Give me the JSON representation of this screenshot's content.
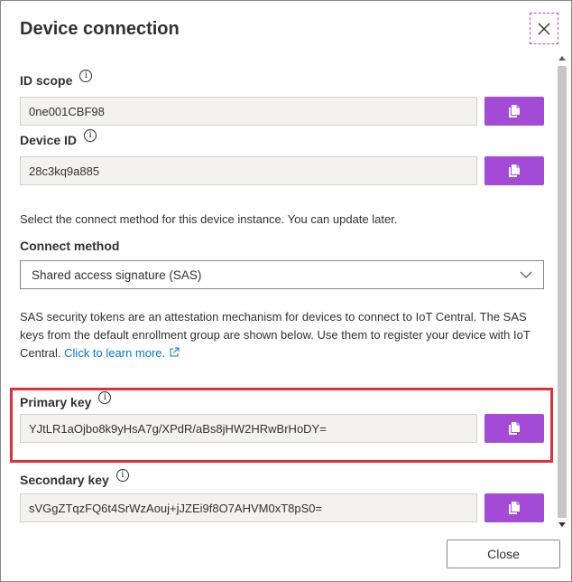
{
  "dialog": {
    "title": "Device connection",
    "close_icon": "close-icon"
  },
  "id_scope": {
    "label": "ID scope",
    "value": "0ne001CBF98"
  },
  "device_id": {
    "label": "Device ID",
    "value": "28c3kq9a885"
  },
  "connect": {
    "instructions": "Select the connect method for this device instance. You can update later.",
    "method_label": "Connect method",
    "method_value": "Shared access signature (SAS)"
  },
  "sas_info": {
    "text": "SAS security tokens are an attestation mechanism for devices to connect to IoT Central. The SAS keys from the default enrollment group are shown below. Use them to register your device with IoT Central.",
    "link": "Click to learn more."
  },
  "primary_key": {
    "label": "Primary key",
    "value": "YJtLR1aOjbo8k9yHsA7g/XPdR/aBs8jHW2HRwBrHoDY="
  },
  "secondary_key": {
    "label": "Secondary key",
    "value": "sVGgZTqzFQ6t4SrWzAouj+jJZEi9f8O7AHVM0xT8pS0="
  },
  "footer": {
    "close_label": "Close"
  },
  "colors": {
    "accent": "#a34ad6",
    "highlight": "#e0303a",
    "link": "#0078d4"
  }
}
